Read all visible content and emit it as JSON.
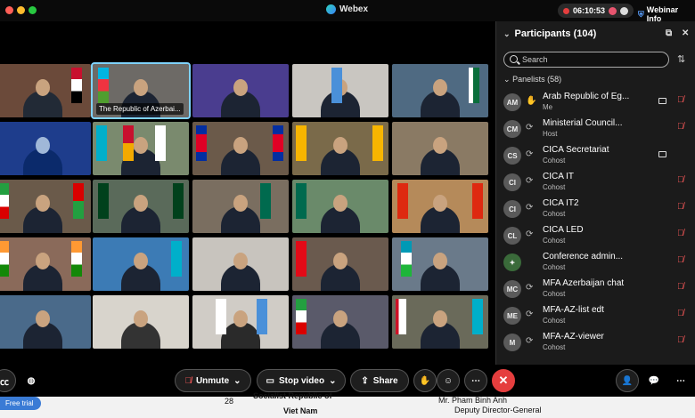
{
  "titlebar": {
    "app_title": "Webex",
    "clock": "06:10:53",
    "webinar_info": "Webinar Info"
  },
  "tiles": [
    {
      "label": ""
    },
    {
      "label": "The Republic of Azerbai..."
    }
  ],
  "panel": {
    "title": "Participants (104)",
    "search_placeholder": "Search",
    "section_label": "Panelists (58)",
    "participants": [
      {
        "initials": "AM",
        "name": "Arab Republic of Eg...",
        "role": "Me"
      },
      {
        "initials": "CM",
        "name": "Ministerial Council...",
        "role": "Host"
      },
      {
        "initials": "CS",
        "name": "CICA Secretariat",
        "role": "Cohost"
      },
      {
        "initials": "CI",
        "name": "CICA IT",
        "role": "Cohost"
      },
      {
        "initials": "CI",
        "name": "CICA IT2",
        "role": "Cohost"
      },
      {
        "initials": "CL",
        "name": "CICA LED",
        "role": "Cohost"
      },
      {
        "initials": "",
        "name": "Conference admin...",
        "role": "Cohost"
      },
      {
        "initials": "MC",
        "name": "MFA Azerbaijan chat",
        "role": "Cohost"
      },
      {
        "initials": "ME",
        "name": "MFA-AZ-list edt",
        "role": "Cohost"
      },
      {
        "initials": "M",
        "name": "MFA-AZ-viewer",
        "role": "Cohost"
      }
    ]
  },
  "controls": {
    "unmute": "Unmute",
    "stop_video": "Stop video",
    "share": "Share"
  },
  "background_doc": {
    "free_trial": "Free trial",
    "num": "28",
    "line1": "Socialist Republic of",
    "line2": "Viet Nam",
    "line3": "Mr. Pham Binh Anh",
    "line4": "Deputy Director-General"
  },
  "colors": {
    "accent": "#7fd3ff",
    "end_call": "#e53e3e",
    "muted_icon": "#ff5a5a"
  }
}
